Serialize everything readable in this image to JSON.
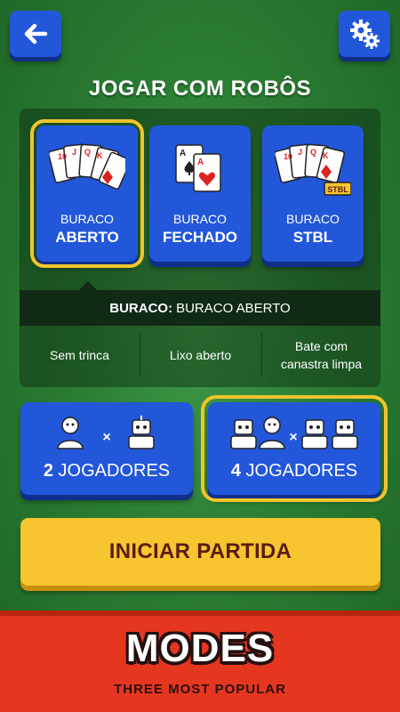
{
  "header": {
    "back_icon": "arrow-left-icon",
    "settings_icon": "gears-icon",
    "title": "JOGAR COM ROBÔS"
  },
  "modes": [
    {
      "sub": "BURACO",
      "name": "ABERTO",
      "selected": true
    },
    {
      "sub": "BURACO",
      "name": "FECHADO",
      "selected": false
    },
    {
      "sub": "BURACO",
      "name": "STBL",
      "selected": false,
      "badge": "STBL"
    }
  ],
  "rules": {
    "label": "BURACO:",
    "value": "BURACO ABERTO",
    "items": [
      "Sem trinca",
      "Lixo aberto",
      "Bate com canastra limpa"
    ]
  },
  "players": [
    {
      "count": "2",
      "label": "JOGADORES",
      "versus": "×",
      "selected": false
    },
    {
      "count": "4",
      "label": "JOGADORES",
      "versus": "×",
      "selected": true
    }
  ],
  "start_label": "INICIAR PARTIDA",
  "promo": {
    "title": "MODES",
    "subtitle": "THREE MOST POPULAR"
  },
  "colors": {
    "felt": "#2b7d33",
    "button_blue": "#2357d9",
    "highlight": "#f2c52d",
    "start_yellow": "#f6c52f",
    "promo_red": "#e5361f"
  }
}
